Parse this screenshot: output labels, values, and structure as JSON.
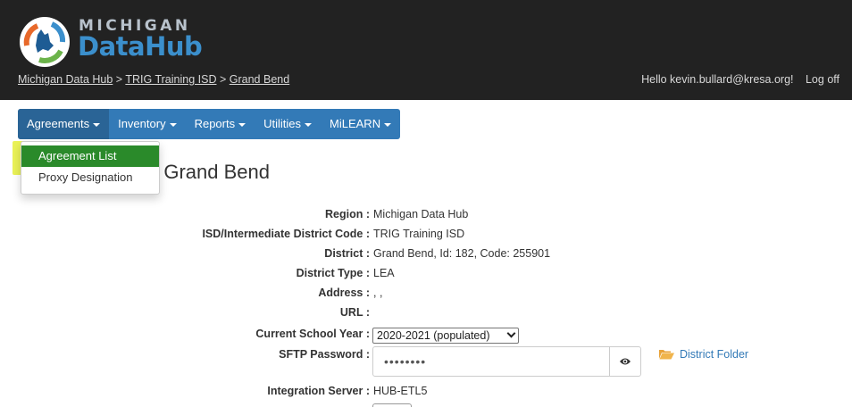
{
  "header": {
    "logo_top": "MICHIGAN",
    "logo_bottom": "DataHub",
    "breadcrumb": [
      "Michigan Data Hub",
      "TRIG Training ISD",
      "Grand Bend"
    ],
    "breadcrumb_sep": ">",
    "greeting": "Hello kevin.bullard@kresa.org!",
    "logoff": "Log off"
  },
  "nav": {
    "items": [
      {
        "label": "Agreements"
      },
      {
        "label": "Inventory"
      },
      {
        "label": "Reports"
      },
      {
        "label": "Utilities"
      },
      {
        "label": "MiLEARN"
      }
    ]
  },
  "dropdown": {
    "items": [
      {
        "label": "Agreement List"
      },
      {
        "label": "Proxy Designation"
      }
    ]
  },
  "page": {
    "title_fragment": "t: Grand Bend"
  },
  "details": {
    "rows": [
      {
        "label": "Region :",
        "value": "Michigan Data Hub"
      },
      {
        "label": "ISD/Intermediate District Code :",
        "value": "TRIG Training ISD"
      },
      {
        "label": "District :",
        "value": "Grand Bend, Id: 182, Code: 255901"
      },
      {
        "label": "District Type :",
        "value": "LEA"
      },
      {
        "label": "Address :",
        "value": ", ,"
      },
      {
        "label": "URL :",
        "value": ""
      },
      {
        "label": "Current School Year :",
        "value": ""
      },
      {
        "label": "SFTP Password :",
        "value": ""
      },
      {
        "label": "Integration Server :",
        "value": "HUB-ETL5"
      }
    ],
    "school_year": "2020-2021 (populated)",
    "password_mask": "••••••••",
    "folder_link": "District Folder"
  },
  "colors": {
    "header_bg": "#222222",
    "nav_bg": "#337ab7",
    "highlight": "#e6f03a",
    "link": "#337ab7"
  }
}
